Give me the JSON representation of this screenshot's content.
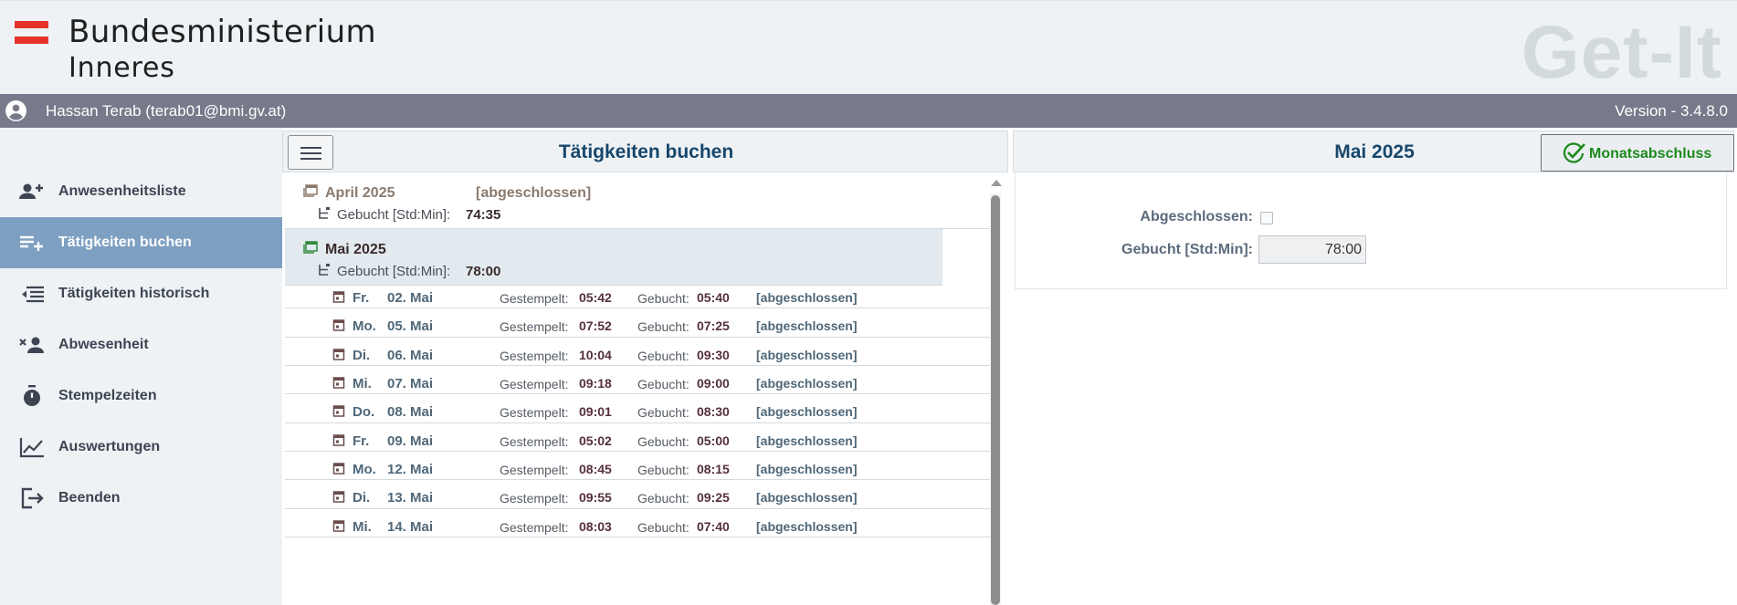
{
  "header": {
    "logo_line1": "Bundesministerium",
    "logo_line2": "Inneres",
    "app_brand": "Get-It"
  },
  "user_bar": {
    "user": "Hassan Terab (terab01@bmi.gv.at)",
    "version": "Version - 3.4.8.0"
  },
  "sidebar": {
    "items": [
      {
        "label": "Anwesenheitsliste",
        "icon": "add-user-icon",
        "active": false
      },
      {
        "label": "Tätigkeiten buchen",
        "icon": "playlist-add-icon",
        "active": true
      },
      {
        "label": "Tätigkeiten historisch",
        "icon": "list-history-icon",
        "active": false
      },
      {
        "label": "Abwesenheit",
        "icon": "remove-user-icon",
        "active": false
      },
      {
        "label": "Stempelzeiten",
        "icon": "stopwatch-icon",
        "active": false
      },
      {
        "label": "Auswertungen",
        "icon": "line-chart-icon",
        "active": false
      },
      {
        "label": "Beenden",
        "icon": "exit-icon",
        "active": false
      }
    ]
  },
  "middle": {
    "title": "Tätigkeiten buchen",
    "months": [
      {
        "name": "April 2025",
        "status": "[abgeschlossen]",
        "booked_label": "Gebucht [Std:Min]:",
        "booked": "74:35",
        "selected": false
      },
      {
        "name": "Mai 2025",
        "status": "",
        "booked_label": "Gebucht [Std:Min]:",
        "booked": "78:00",
        "selected": true
      }
    ],
    "days": [
      {
        "weekday": "Fr.",
        "date": "02. Mai",
        "stamped_label": "Gestempelt:",
        "stamped": "05:42",
        "booked_label": "Gebucht:",
        "booked": "05:40",
        "status": "[abgeschlossen]"
      },
      {
        "weekday": "Mo.",
        "date": "05. Mai",
        "stamped_label": "Gestempelt:",
        "stamped": "07:52",
        "booked_label": "Gebucht:",
        "booked": "07:25",
        "status": "[abgeschlossen]"
      },
      {
        "weekday": "Di.",
        "date": "06. Mai",
        "stamped_label": "Gestempelt:",
        "stamped": "10:04",
        "booked_label": "Gebucht:",
        "booked": "09:30",
        "status": "[abgeschlossen]"
      },
      {
        "weekday": "Mi.",
        "date": "07. Mai",
        "stamped_label": "Gestempelt:",
        "stamped": "09:18",
        "booked_label": "Gebucht:",
        "booked": "09:00",
        "status": "[abgeschlossen]"
      },
      {
        "weekday": "Do.",
        "date": "08. Mai",
        "stamped_label": "Gestempelt:",
        "stamped": "09:01",
        "booked_label": "Gebucht:",
        "booked": "08:30",
        "status": "[abgeschlossen]"
      },
      {
        "weekday": "Fr.",
        "date": "09. Mai",
        "stamped_label": "Gestempelt:",
        "stamped": "05:02",
        "booked_label": "Gebucht:",
        "booked": "05:00",
        "status": "[abgeschlossen]"
      },
      {
        "weekday": "Mo.",
        "date": "12. Mai",
        "stamped_label": "Gestempelt:",
        "stamped": "08:45",
        "booked_label": "Gebucht:",
        "booked": "08:15",
        "status": "[abgeschlossen]"
      },
      {
        "weekday": "Di.",
        "date": "13. Mai",
        "stamped_label": "Gestempelt:",
        "stamped": "09:55",
        "booked_label": "Gebucht:",
        "booked": "09:25",
        "status": "[abgeschlossen]"
      },
      {
        "weekday": "Mi.",
        "date": "14. Mai",
        "stamped_label": "Gestempelt:",
        "stamped": "08:03",
        "booked_label": "Gebucht:",
        "booked": "07:40",
        "status": "[abgeschlossen]"
      }
    ]
  },
  "right": {
    "title": "Mai 2025",
    "close_button": "Monatsabschluss",
    "closed_label": "Abgeschlossen:",
    "closed_checked": false,
    "booked_label": "Gebucht [Std:Min]:",
    "booked_value": "78:00"
  },
  "colors": {
    "accent_blue": "#17476b",
    "sidebar_active": "#7d9fc1",
    "user_bar": "#787a8b",
    "success_green": "#1c8a1c",
    "flag_red": "#e6332a"
  }
}
